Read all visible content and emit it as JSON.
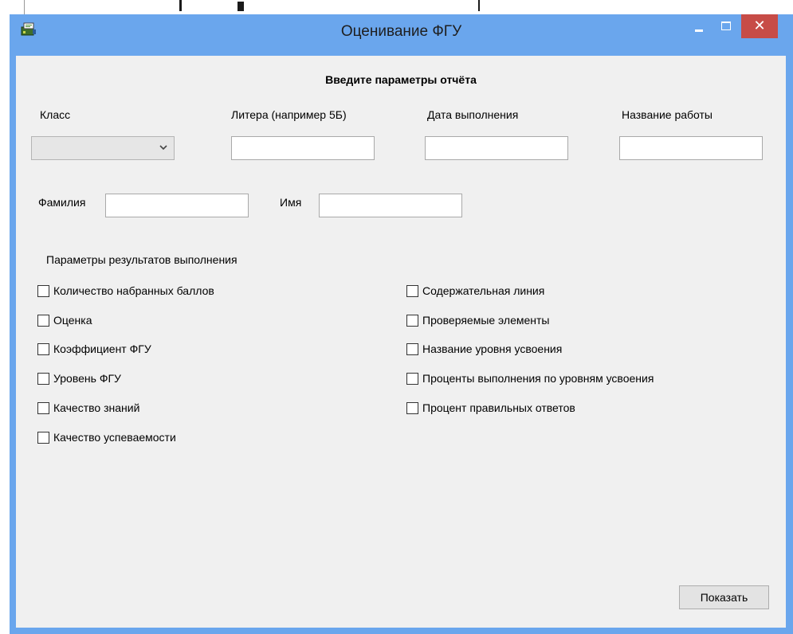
{
  "window": {
    "title": "Оценивание ФГУ",
    "close_glyph": "✕",
    "accent_color": "#6aa6ed",
    "close_color": "#c74c47",
    "app_icon": "app-icon"
  },
  "form": {
    "heading": "Введите параметры отчёта",
    "fields": {
      "class": {
        "label": "Класс",
        "value": ""
      },
      "letter": {
        "label": "Литера (например 5Б)",
        "value": ""
      },
      "date": {
        "label": "Дата выполнения",
        "value": ""
      },
      "work_name": {
        "label": "Название работы",
        "value": ""
      },
      "surname": {
        "label": "Фамилия",
        "value": ""
      },
      "name": {
        "label": "Имя",
        "value": ""
      }
    },
    "results_label": "Параметры результатов выполнения",
    "checkboxes_left": [
      {
        "label": "Количество набранных баллов",
        "checked": false
      },
      {
        "label": "Оценка",
        "checked": false
      },
      {
        "label": "Коэффициент ФГУ",
        "checked": false
      },
      {
        "label": "Уровень ФГУ",
        "checked": false
      },
      {
        "label": "Качество знаний",
        "checked": false
      },
      {
        "label": "Качество успеваемости",
        "checked": false
      }
    ],
    "checkboxes_right": [
      {
        "label": "Содержательная линия",
        "checked": false
      },
      {
        "label": "Проверяемые элементы",
        "checked": false
      },
      {
        "label": "Название уровня усвоения",
        "checked": false
      },
      {
        "label": "Проценты выполнения по уровням усвоения",
        "checked": false
      },
      {
        "label": "Процент правильных ответов",
        "checked": false
      }
    ],
    "show_button": "Показать"
  }
}
